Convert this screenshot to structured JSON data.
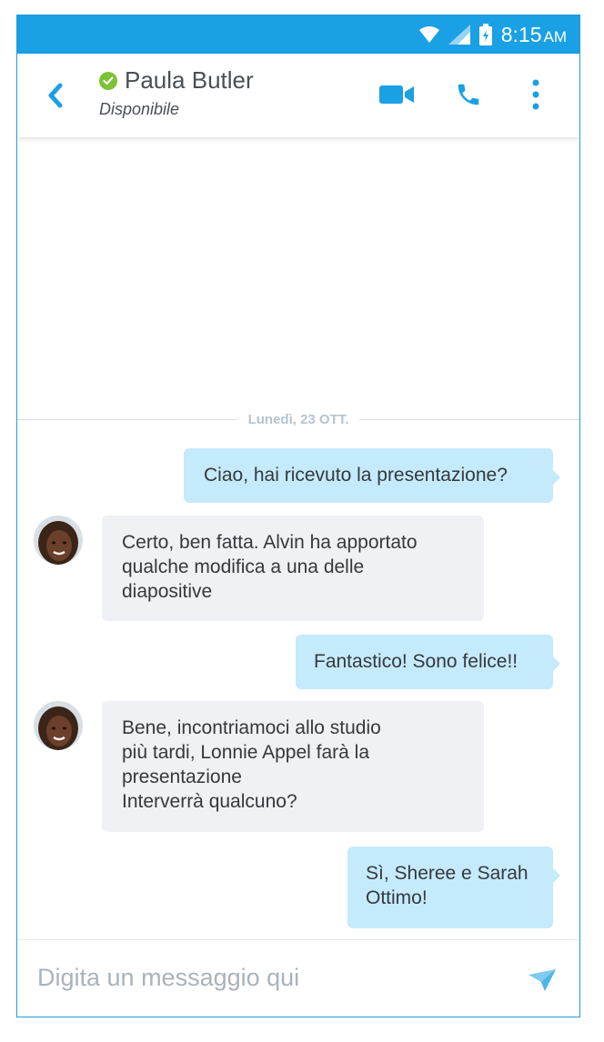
{
  "status_bar": {
    "time": "8:15",
    "ampm": "AM",
    "icons": [
      "wifi-icon",
      "cell-signal-icon",
      "battery-icon"
    ]
  },
  "header": {
    "contact_name": "Paula Butler",
    "contact_status": "Disponibile",
    "icons": [
      "back-icon",
      "presence-available-icon",
      "video-call-icon",
      "phone-call-icon",
      "more-options-icon"
    ]
  },
  "chat": {
    "date_label": "Lunedì, 23 OTT.",
    "messages": [
      {
        "dir": "out",
        "text": "Ciao, hai ricevuto la presentazione?"
      },
      {
        "dir": "in",
        "text": "Certo, ben fatta. Alvin ha apportato\nqualche modifica a una delle\ndiapositive"
      },
      {
        "dir": "out",
        "text": "Fantastico! Sono felice!!"
      },
      {
        "dir": "in",
        "text": "Bene, incontriamoci allo studio\npiù tardi, Lonnie Appel farà la\npresentazione\nInterverrà qualcuno?"
      },
      {
        "dir": "out",
        "text": "Sì, Sheree e Sarah\nOttimo!"
      }
    ]
  },
  "composer": {
    "placeholder": "Digita un messaggio qui",
    "value": "",
    "send_icon": "send-icon"
  },
  "colors": {
    "accent": "#1aa0e4",
    "outgoing_bubble": "#c5eafb",
    "incoming_bubble": "#eff1f4",
    "presence": "#7cc236"
  }
}
